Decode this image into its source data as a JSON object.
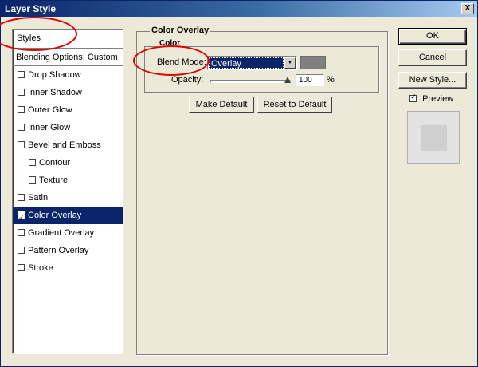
{
  "window": {
    "title": "Layer Style",
    "close_label": "X"
  },
  "styles_panel": {
    "header": "Styles",
    "blending_options": "Blending Options: Custom",
    "items": [
      {
        "label": "Drop Shadow",
        "checked": false,
        "sub": false,
        "selected": false
      },
      {
        "label": "Inner Shadow",
        "checked": false,
        "sub": false,
        "selected": false
      },
      {
        "label": "Outer Glow",
        "checked": false,
        "sub": false,
        "selected": false
      },
      {
        "label": "Inner Glow",
        "checked": false,
        "sub": false,
        "selected": false
      },
      {
        "label": "Bevel and Emboss",
        "checked": false,
        "sub": false,
        "selected": false
      },
      {
        "label": "Contour",
        "checked": false,
        "sub": true,
        "selected": false
      },
      {
        "label": "Texture",
        "checked": false,
        "sub": true,
        "selected": false
      },
      {
        "label": "Satin",
        "checked": false,
        "sub": false,
        "selected": false
      },
      {
        "label": "Color Overlay",
        "checked": true,
        "sub": false,
        "selected": true
      },
      {
        "label": "Gradient Overlay",
        "checked": false,
        "sub": false,
        "selected": false
      },
      {
        "label": "Pattern Overlay",
        "checked": false,
        "sub": false,
        "selected": false
      },
      {
        "label": "Stroke",
        "checked": false,
        "sub": false,
        "selected": false
      }
    ]
  },
  "color_overlay": {
    "group_title": "Color Overlay",
    "sub_group_title": "Color",
    "blend_mode_label": "Blend Mode:",
    "blend_mode_value": "Overlay",
    "overlay_color": "#808080",
    "opacity_label": "Opacity:",
    "opacity_value": "100",
    "opacity_unit": "%",
    "opacity_level": 100,
    "make_default": "Make Default",
    "reset_to_default": "Reset to Default"
  },
  "actions": {
    "ok": "OK",
    "cancel": "Cancel",
    "new_style": "New Style...",
    "preview_label": "Preview",
    "preview_checked": true
  },
  "colors": {
    "title_bar": "#0a246a",
    "selection": "#0a246a",
    "annotation": "#e00000"
  }
}
